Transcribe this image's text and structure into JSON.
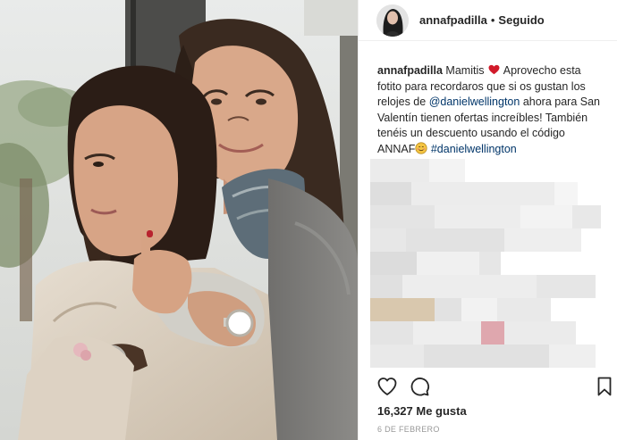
{
  "header": {
    "username": "annafpadilla",
    "separator": "•",
    "follow_status": "Seguido",
    "avatar_icon": "profile-avatar"
  },
  "caption": {
    "username": "annafpadilla",
    "part1": "Mamitis",
    "heart_emoji": "red-heart",
    "part2": "Aprovecho esta fotito para recordaros que si os gustan los relojes de",
    "mention": "@danielwellington",
    "part3": "ahora para San Valentín tienen ofertas increíbles! También tenéis un descuento usando el código ANNAF",
    "blush_emoji": "smiling-face",
    "hashtag": "#danielwellington"
  },
  "actions": {
    "like_icon": "heart-outline-icon",
    "comment_icon": "comment-bubble-icon",
    "save_icon": "bookmark-icon"
  },
  "likes": {
    "text": "16,327 Me gusta"
  },
  "date": {
    "text": "6 de febrero"
  },
  "colors": {
    "link": "#003569",
    "text": "#262626",
    "muted": "#999999",
    "border": "#efefef",
    "heart_emoji": "#d11a2a"
  }
}
